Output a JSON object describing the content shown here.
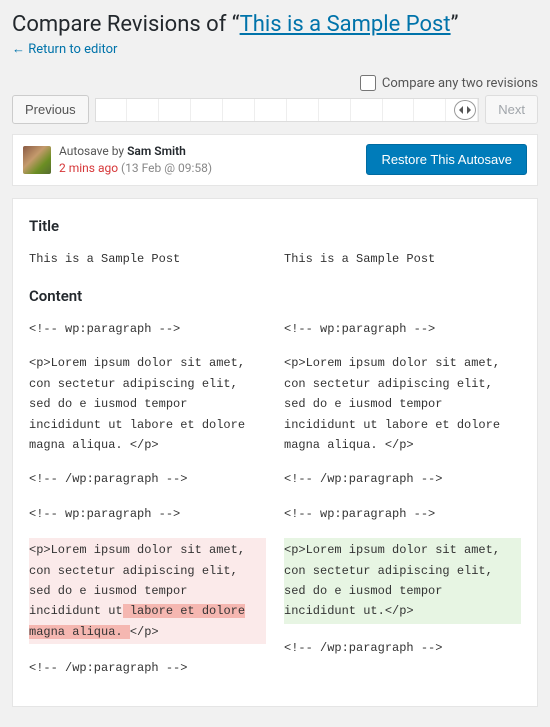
{
  "header": {
    "title_prefix": "Compare Revisions of “",
    "post_title": "This is a Sample Post",
    "title_suffix": "”",
    "return_link": "← Return to editor",
    "compare_any": "Compare any two revisions"
  },
  "nav": {
    "previous": "Previous",
    "next": "Next"
  },
  "meta": {
    "autosave_by": "Autosave by ",
    "author": "Sam Smith",
    "ago": "2 mins ago",
    "date": " (13 Feb @ 09:58)",
    "restore_btn": "Restore This Autosave"
  },
  "diff": {
    "title_heading": "Title",
    "content_heading": "Content",
    "left": {
      "title_val": "This is a Sample Post",
      "p1": "<!-- wp:paragraph -->",
      "p2": "<p>Lorem ipsum dolor sit amet, con sectetur adipiscing elit, sed do e iusmod tempor incididunt ut labore et dolore magna aliqua. </p>",
      "p3": "<!-- /wp:paragraph -->",
      "p4": "<!-- wp:paragraph -->",
      "p5a": "<p>Lorem ipsum dolor sit amet, con sectetur adipiscing elit, sed do e iusmod tempor incididunt ut",
      "p5b": " labore et dolore magna aliqua. ",
      "p5c": "</p>",
      "p6": "<!-- /wp:paragraph -->"
    },
    "right": {
      "title_val": "This is a Sample Post",
      "p1": "<!-- wp:paragraph -->",
      "p2": "<p>Lorem ipsum dolor sit amet, con sectetur adipiscing elit, sed do e iusmod tempor incididunt ut labore et dolore magna aliqua. </p>",
      "p3": "<!-- /wp:paragraph -->",
      "p4": "<!-- wp:paragraph -->",
      "p5": "<p>Lorem ipsum dolor sit amet, con sectetur adipiscing elit, sed do e iusmod tempor incididunt ut.</p>",
      "p6": "<!-- /wp:paragraph -->"
    }
  }
}
